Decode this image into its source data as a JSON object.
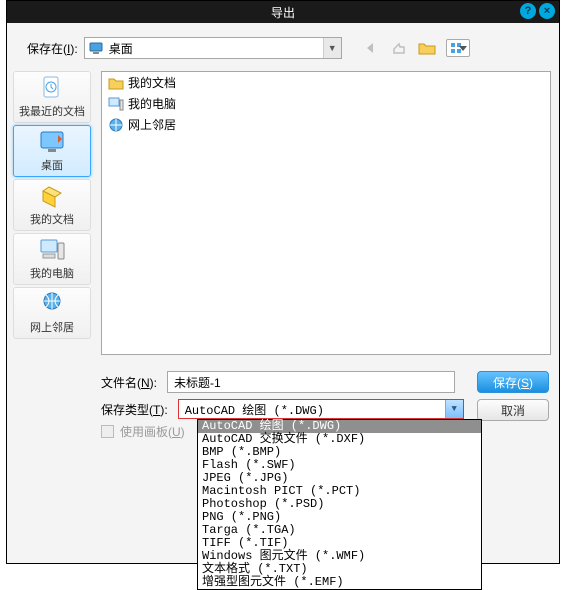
{
  "dialog": {
    "title": "导出",
    "help_tip": "?",
    "close_tip": "×"
  },
  "savein": {
    "label_pre": "保存在(",
    "label_u": "I",
    "label_post": "):",
    "value": "桌面"
  },
  "sidebar": {
    "items": [
      {
        "label": "我最近的文档"
      },
      {
        "label": "桌面"
      },
      {
        "label": "我的文档"
      },
      {
        "label": "我的电脑"
      },
      {
        "label": "网上邻居"
      }
    ]
  },
  "filepanel": {
    "items": [
      {
        "label": "我的文档",
        "icon": "folder"
      },
      {
        "label": "我的电脑",
        "icon": "computer"
      },
      {
        "label": "网上邻居",
        "icon": "network"
      }
    ]
  },
  "filename": {
    "label_pre": "文件名(",
    "label_u": "N",
    "label_post": "):",
    "value": "未标题-1"
  },
  "filetype": {
    "label_pre": "保存类型(",
    "label_u": "T",
    "label_post": "):",
    "value": "AutoCAD 绘图 (*.DWG)"
  },
  "filetype_options": [
    "AutoCAD 绘图 (*.DWG)",
    "AutoCAD 交换文件 (*.DXF)",
    "BMP (*.BMP)",
    "Flash (*.SWF)",
    "JPEG (*.JPG)",
    "Macintosh PICT (*.PCT)",
    "Photoshop (*.PSD)",
    "PNG (*.PNG)",
    "Targa (*.TGA)",
    "TIFF (*.TIF)",
    "Windows 图元文件 (*.WMF)",
    "文本格式 (*.TXT)",
    "增强型图元文件 (*.EMF)"
  ],
  "filetype_highlight_index": 0,
  "buttons": {
    "save_pre": "保存(",
    "save_u": "S",
    "save_post": ")",
    "cancel": "取消"
  },
  "artboard": {
    "label_pre": "使用画板(",
    "label_u": "U",
    "label_post": ")"
  }
}
